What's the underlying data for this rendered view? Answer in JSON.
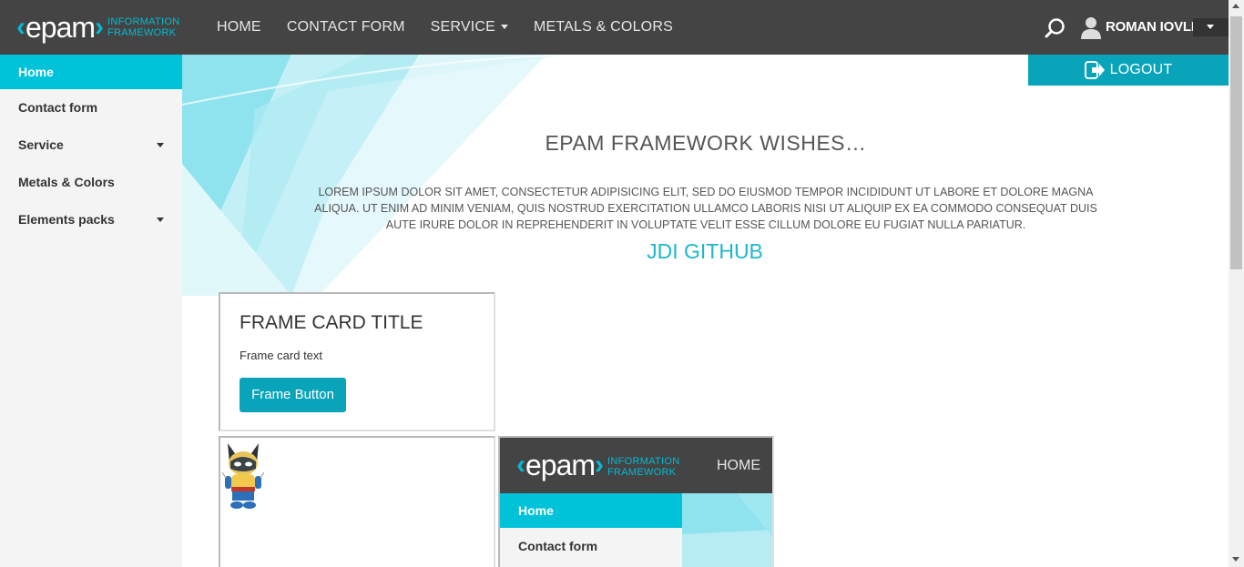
{
  "header": {
    "logo_text": "epam",
    "logo_sub_line1": "INFORMATION",
    "logo_sub_line2": "FRAMEWORK",
    "nav": [
      {
        "label": "HOME"
      },
      {
        "label": "CONTACT FORM"
      },
      {
        "label": "SERVICE"
      },
      {
        "label": "METALS & COLORS"
      }
    ],
    "user_name": "ROMAN IOVLEV"
  },
  "sidebar": {
    "items": [
      {
        "label": "Home",
        "active": true
      },
      {
        "label": "Contact form"
      },
      {
        "label": "Service",
        "has_submenu": true
      },
      {
        "label": "Metals & Colors"
      },
      {
        "label": "Elements packs",
        "has_submenu": true
      }
    ]
  },
  "main": {
    "logout_label": "LOGOUT",
    "title": "EPAM FRAMEWORK WISHES…",
    "text": "LOREM IPSUM DOLOR SIT AMET, CONSECTETUR ADIPISICING ELIT, SED DO EIUSMOD TEMPOR INCIDIDUNT UT LABORE ET DOLORE MAGNA ALIQUA. UT ENIM AD MINIM VENIAM, QUIS NOSTRUD EXERCITATION ULLAMCO LABORIS NISI UT ALIQUIP EX EA COMMODO CONSEQUAT DUIS AUTE IRURE DOLOR IN REPREHENDERIT IN VOLUPTATE VELIT ESSE CILLUM DOLORE EU FUGIAT NULLA PARIATUR.",
    "link_label": "JDI GITHUB"
  },
  "frame_card": {
    "title": "FRAME CARD TITLE",
    "text": "Frame card text",
    "button_label": "Frame Button"
  },
  "mini_frame": {
    "logo_text": "epam",
    "logo_sub_line1": "INFORMATION",
    "logo_sub_line2": "FRAMEWORK",
    "nav_label": "HOME",
    "sidebar": [
      {
        "label": "Home",
        "active": true
      },
      {
        "label": "Contact form"
      }
    ]
  },
  "colors": {
    "header_bg": "#444445",
    "accent": "#00c3da",
    "button": "#0aa4ba",
    "link": "#1eb6cc"
  }
}
